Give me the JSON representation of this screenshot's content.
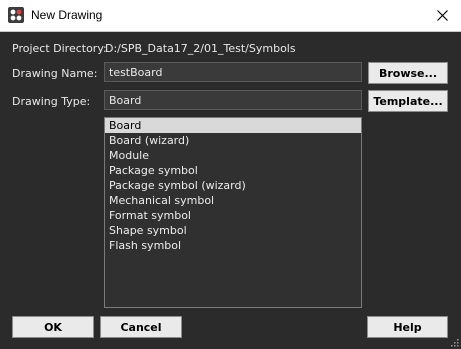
{
  "window": {
    "title": "New Drawing",
    "close_icon": "close-icon",
    "app_icon": "drawing-app-icon"
  },
  "form": {
    "project_directory_label": "Project Directory:",
    "project_directory_value": "D:/SPB_Data17_2/01_Test/Symbols",
    "drawing_name_label": "Drawing Name:",
    "drawing_name_value": "testBoard",
    "drawing_type_label": "Drawing Type:",
    "drawing_type_value": "Board",
    "browse_label": "Browse...",
    "template_label": "Template..."
  },
  "type_list": {
    "selected": "Board",
    "items": [
      "Board",
      "Board (wizard)",
      "Module",
      "Package symbol",
      "Package symbol (wizard)",
      "Mechanical symbol",
      "Format symbol",
      "Shape symbol",
      "Flash symbol"
    ]
  },
  "footer": {
    "ok_label": "OK",
    "cancel_label": "Cancel",
    "help_label": "Help"
  },
  "colors": {
    "background": "#2b2b2b",
    "selection": "#d9d9d9",
    "button": "#eaeaea"
  }
}
